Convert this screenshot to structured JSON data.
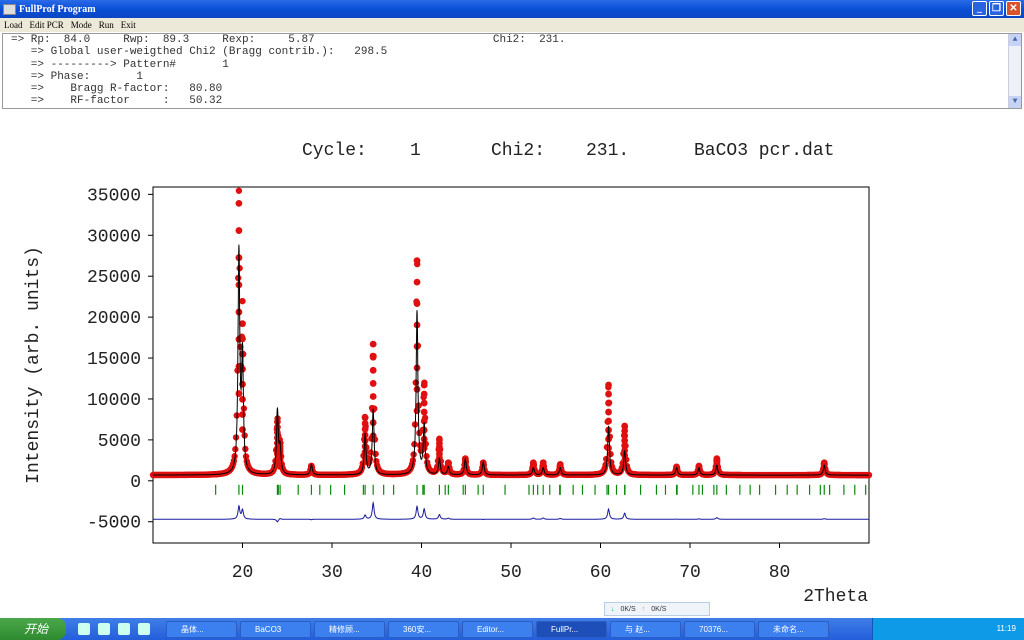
{
  "window": {
    "title": "FullProf Program",
    "menu": [
      "Load",
      "Edit PCR",
      "Mode",
      "Run",
      "Exit"
    ]
  },
  "console": {
    "lines": [
      "=> Rp:  84.0     Rwp:  89.3     Rexp:     5.87                           Chi2:  231.",
      "   => Global user-weigthed Chi2 (Bragg contrib.):   298.5",
      "   => ---------> Pattern#       1",
      "   => Phase:       1",
      "   =>    Bragg R-factor:   80.80",
      "   =>    RF-factor     :   50.32"
    ]
  },
  "plot_header": {
    "cycle_label": "Cycle:",
    "cycle": "1",
    "chi2_label": "Chi2:",
    "chi2": "231.",
    "file": "BaCO3 pcr.dat"
  },
  "chart_data": {
    "type": "scatter",
    "xlabel": "2Theta",
    "ylabel": "Intensity (arb. units)",
    "xlim": [
      10,
      90
    ],
    "ylim": [
      -7600,
      35900
    ],
    "xticks": [
      20,
      30,
      40,
      50,
      60,
      70,
      80
    ],
    "yticks": [
      -5000,
      0,
      5000,
      10000,
      15000,
      20000,
      25000,
      30000,
      35000
    ],
    "background": 700,
    "difference_offset": -4700,
    "peaks": [
      {
        "x": 19.6,
        "obs": 33200,
        "calc": 27000
      },
      {
        "x": 20.0,
        "obs": 18500,
        "calc": 14000
      },
      {
        "x": 23.9,
        "obs": 6500,
        "calc": 7800
      },
      {
        "x": 24.2,
        "obs": 3500,
        "calc": 3000
      },
      {
        "x": 27.7,
        "obs": 1100,
        "calc": 1300
      },
      {
        "x": 33.7,
        "obs": 7000,
        "calc": 5000
      },
      {
        "x": 34.6,
        "obs": 16000,
        "calc": 8000
      },
      {
        "x": 39.5,
        "obs": 26200,
        "calc": 20000
      },
      {
        "x": 40.3,
        "obs": 11000,
        "calc": 6000
      },
      {
        "x": 42.0,
        "obs": 4300,
        "calc": 2000
      },
      {
        "x": 43.0,
        "obs": 1500,
        "calc": 1000
      },
      {
        "x": 44.9,
        "obs": 2000,
        "calc": 2000
      },
      {
        "x": 46.9,
        "obs": 1500,
        "calc": 1600
      },
      {
        "x": 52.5,
        "obs": 1500,
        "calc": 900
      },
      {
        "x": 53.6,
        "obs": 1500,
        "calc": 900
      },
      {
        "x": 55.5,
        "obs": 1300,
        "calc": 900
      },
      {
        "x": 60.9,
        "obs": 11000,
        "calc": 6000
      },
      {
        "x": 62.7,
        "obs": 6000,
        "calc": 3000
      },
      {
        "x": 68.5,
        "obs": 1000,
        "calc": 900
      },
      {
        "x": 71.0,
        "obs": 1100,
        "calc": 900
      },
      {
        "x": 73.0,
        "obs": 2000,
        "calc": 1200
      },
      {
        "x": 85.0,
        "obs": 1500,
        "calc": 1200
      }
    ],
    "colors": {
      "observed": "#e01010",
      "calculated": "#000000",
      "difference": "#1a1aa0",
      "bragg": "#0a8a0a"
    }
  },
  "taskbar": {
    "start": "开始",
    "tasks": [
      "晶体...",
      "BaCO3",
      "精修顾...",
      "360安...",
      "Editor...",
      "FullPr...",
      "与 赵...",
      "70376...",
      "未命名..."
    ],
    "net_down": "0K/S",
    "net_up": "0K/S",
    "clock": "11:19"
  }
}
